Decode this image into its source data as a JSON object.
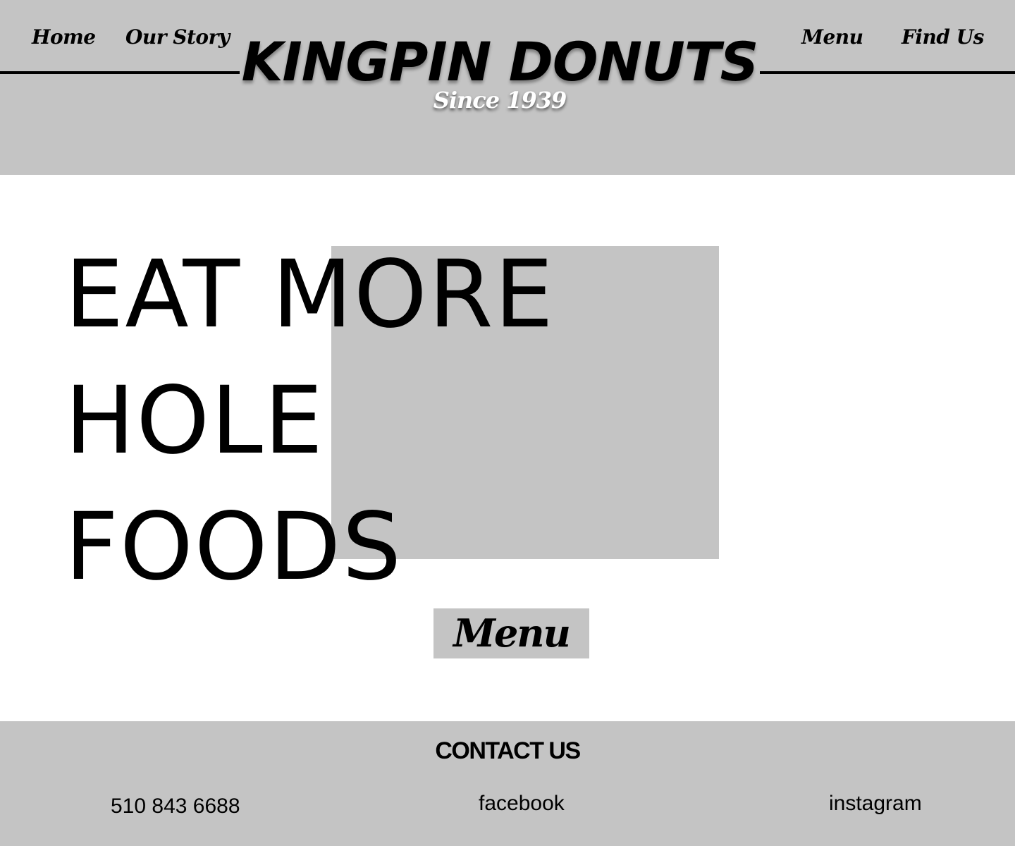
{
  "nav": {
    "home": "Home",
    "our_story": "Our Story",
    "menu": "Menu",
    "find_us": "Find Us"
  },
  "brand": {
    "title": "KINGPIN DONUTS",
    "subtitle": "Since 1939"
  },
  "hero": {
    "lines": [
      "EAT MORE",
      "HOLE",
      "FOODS"
    ],
    "button_label": "Menu"
  },
  "footer": {
    "title": "CONTACT US",
    "phone": "510 843 6688",
    "facebook": "facebook",
    "instagram": "instagram"
  },
  "colors": {
    "panel_gray": "#c4c4c4",
    "text": "#000000",
    "background": "#ffffff"
  }
}
